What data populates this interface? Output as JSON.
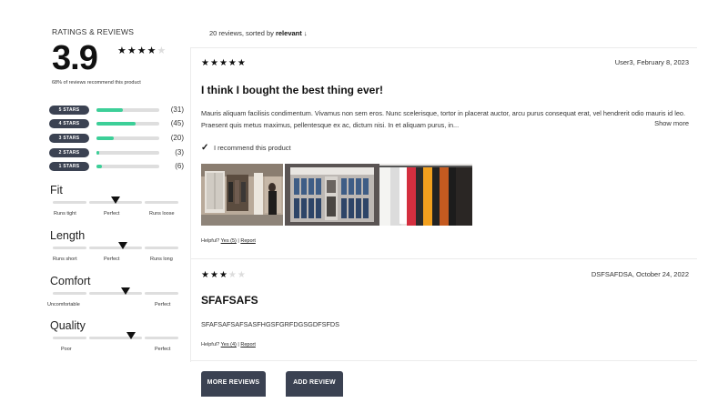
{
  "summary": {
    "title": "RATINGS & REVIEWS",
    "average": "3.9",
    "average_value": 3.9,
    "recommend_text": "68% of reviews recommend this product"
  },
  "distribution": [
    {
      "label": "5 STARS",
      "count_text": "(31)",
      "count": 31
    },
    {
      "label": "4 STARS",
      "count_text": "(45)",
      "count": 45
    },
    {
      "label": "3 STARS",
      "count_text": "(20)",
      "count": 20
    },
    {
      "label": "2 STARS",
      "count_text": "(3)",
      "count": 3
    },
    {
      "label": "1 STARS",
      "count_text": "(6)",
      "count": 6
    }
  ],
  "characteristics": [
    {
      "name": "Fit",
      "labels": [
        "Runs tight",
        "Perfect",
        "Runs loose"
      ],
      "level": 0.5
    },
    {
      "name": "Length",
      "labels": [
        "Runs short",
        "Perfect",
        "Runs long"
      ],
      "level": 0.56
    },
    {
      "name": "Comfort",
      "labels": [
        "Uncomfortable",
        "Perfect"
      ],
      "level": 0.58
    },
    {
      "name": "Quality",
      "labels": [
        "Poor",
        "Perfect"
      ],
      "level": 0.62
    }
  ],
  "sort": {
    "prefix": "20 reviews, sorted by",
    "value": "relevant",
    "arrow": "↓"
  },
  "reviews": [
    {
      "rating": 5,
      "meta": "User3, February 8, 2023",
      "title": "I think I bought the best thing ever!",
      "body": "Mauris aliquam facilisis condimentum. Vivamus non sem eros. Nunc scelerisque, tortor in placerat auctor, arcu purus consequat erat, vel hendrerit odio mauris id leo. Praesent quis metus maximus, pellentesque ex ac, dictum nisi. In et aliquam purus, in...",
      "show_more": "Show more",
      "recommend": "I recommend this product",
      "helpful_label": "Helpful?",
      "helpful_yes": "Yes (5)",
      "report": "Report"
    },
    {
      "rating": 3,
      "meta": "DSFSAFDSA, October 24, 2022",
      "title": "SFAFSAFS",
      "body": "SFAFSAFSAFSASFHGSFGRFDGSGDFSFDS",
      "helpful_label": "Helpful?",
      "helpful_yes": "Yes (4)",
      "report": "Report"
    }
  ],
  "buttons": {
    "more": "MORE REVIEWS",
    "add": "ADD REVIEW"
  },
  "colors": {
    "accent": "#3ccf98",
    "pill": "#3b4252",
    "track": "#dedede"
  }
}
